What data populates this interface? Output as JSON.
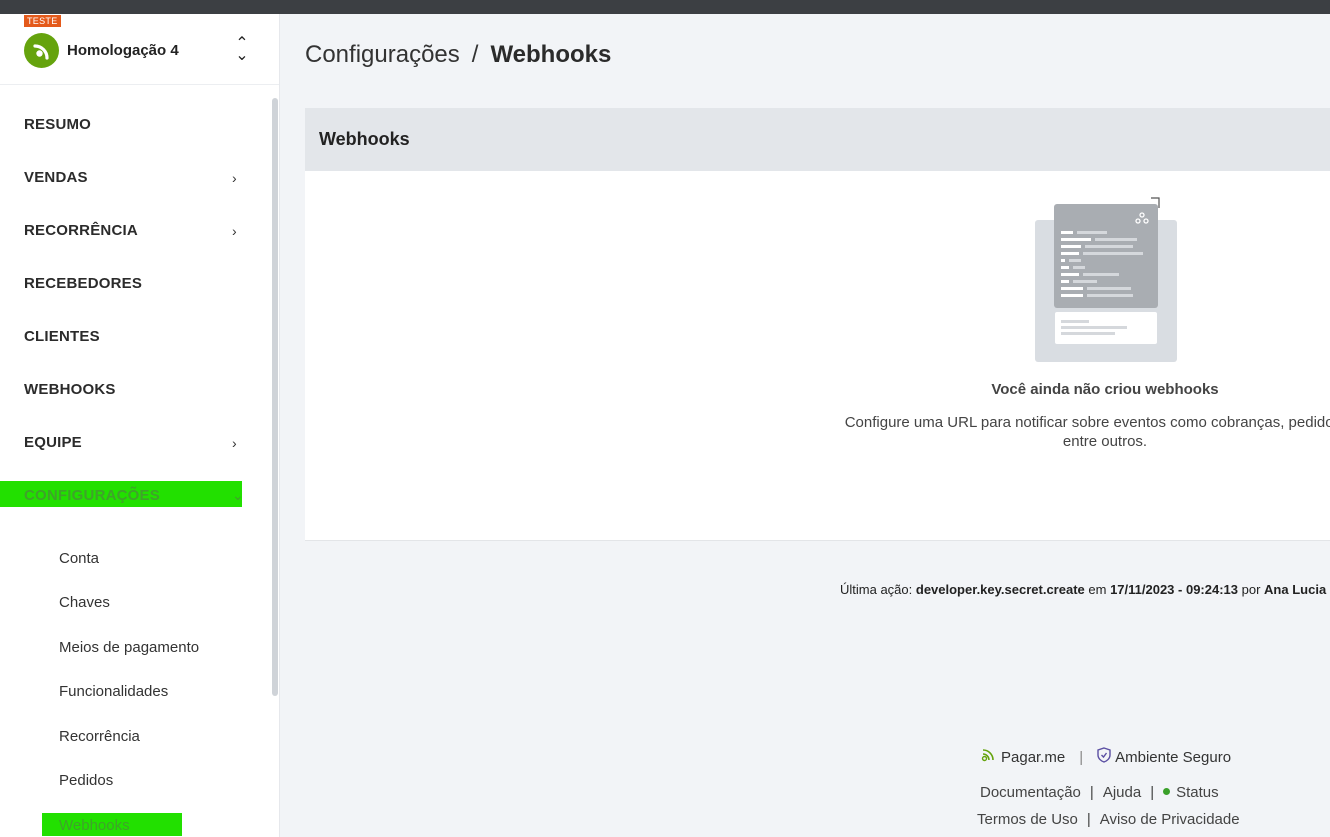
{
  "account": {
    "badge": "TESTE",
    "name": "Homologação 4",
    "switch_icon": "chevron-up-down-icon"
  },
  "nav": {
    "items": [
      {
        "label": "RESUMO",
        "has_chevron": false
      },
      {
        "label": "VENDAS",
        "has_chevron": true
      },
      {
        "label": "RECORRÊNCIA",
        "has_chevron": true
      },
      {
        "label": "RECEBEDORES",
        "has_chevron": false
      },
      {
        "label": "CLIENTES",
        "has_chevron": false
      },
      {
        "label": "WEBHOOKS",
        "has_chevron": false
      },
      {
        "label": "EQUIPE",
        "has_chevron": true
      },
      {
        "label": "CONFIGURAÇÕES",
        "has_chevron": true,
        "expanded": true
      }
    ],
    "chevron_right": "›",
    "chevron_down": "⌄",
    "sub_items": [
      "Conta",
      "Chaves",
      "Meios de pagamento",
      "Funcionalidades",
      "Recorrência",
      "Pedidos",
      "Webhooks"
    ],
    "highlight_color": "#22e000"
  },
  "breadcrumb": {
    "parent": "Configurações",
    "separator": "/",
    "current": "Webhooks"
  },
  "card": {
    "title": "Webhooks",
    "empty_title": "Você ainda não criou webhooks",
    "empty_desc_line1": "Configure uma URL para notificar sobre eventos como cobranças, pedidos, as",
    "empty_desc_line2": "entre outros."
  },
  "last_action": {
    "label": "Última ação:",
    "event": "developer.key.secret.create",
    "on": "em",
    "datetime": "17/11/2023 - 09:24:13",
    "by": "por",
    "user": "Ana Lucia Ba"
  },
  "footer": {
    "brand": "Pagar.me",
    "secure": "Ambiente Seguro",
    "links": {
      "docs": "Documentação",
      "help": "Ajuda",
      "status": "Status",
      "terms": "Termos de Uso",
      "privacy": "Aviso de Privacidade"
    },
    "divider": "|"
  },
  "colors": {
    "brand_green": "#65a30d",
    "badge_orange": "#e45a1b",
    "header_gray": "#e3e6ea"
  }
}
